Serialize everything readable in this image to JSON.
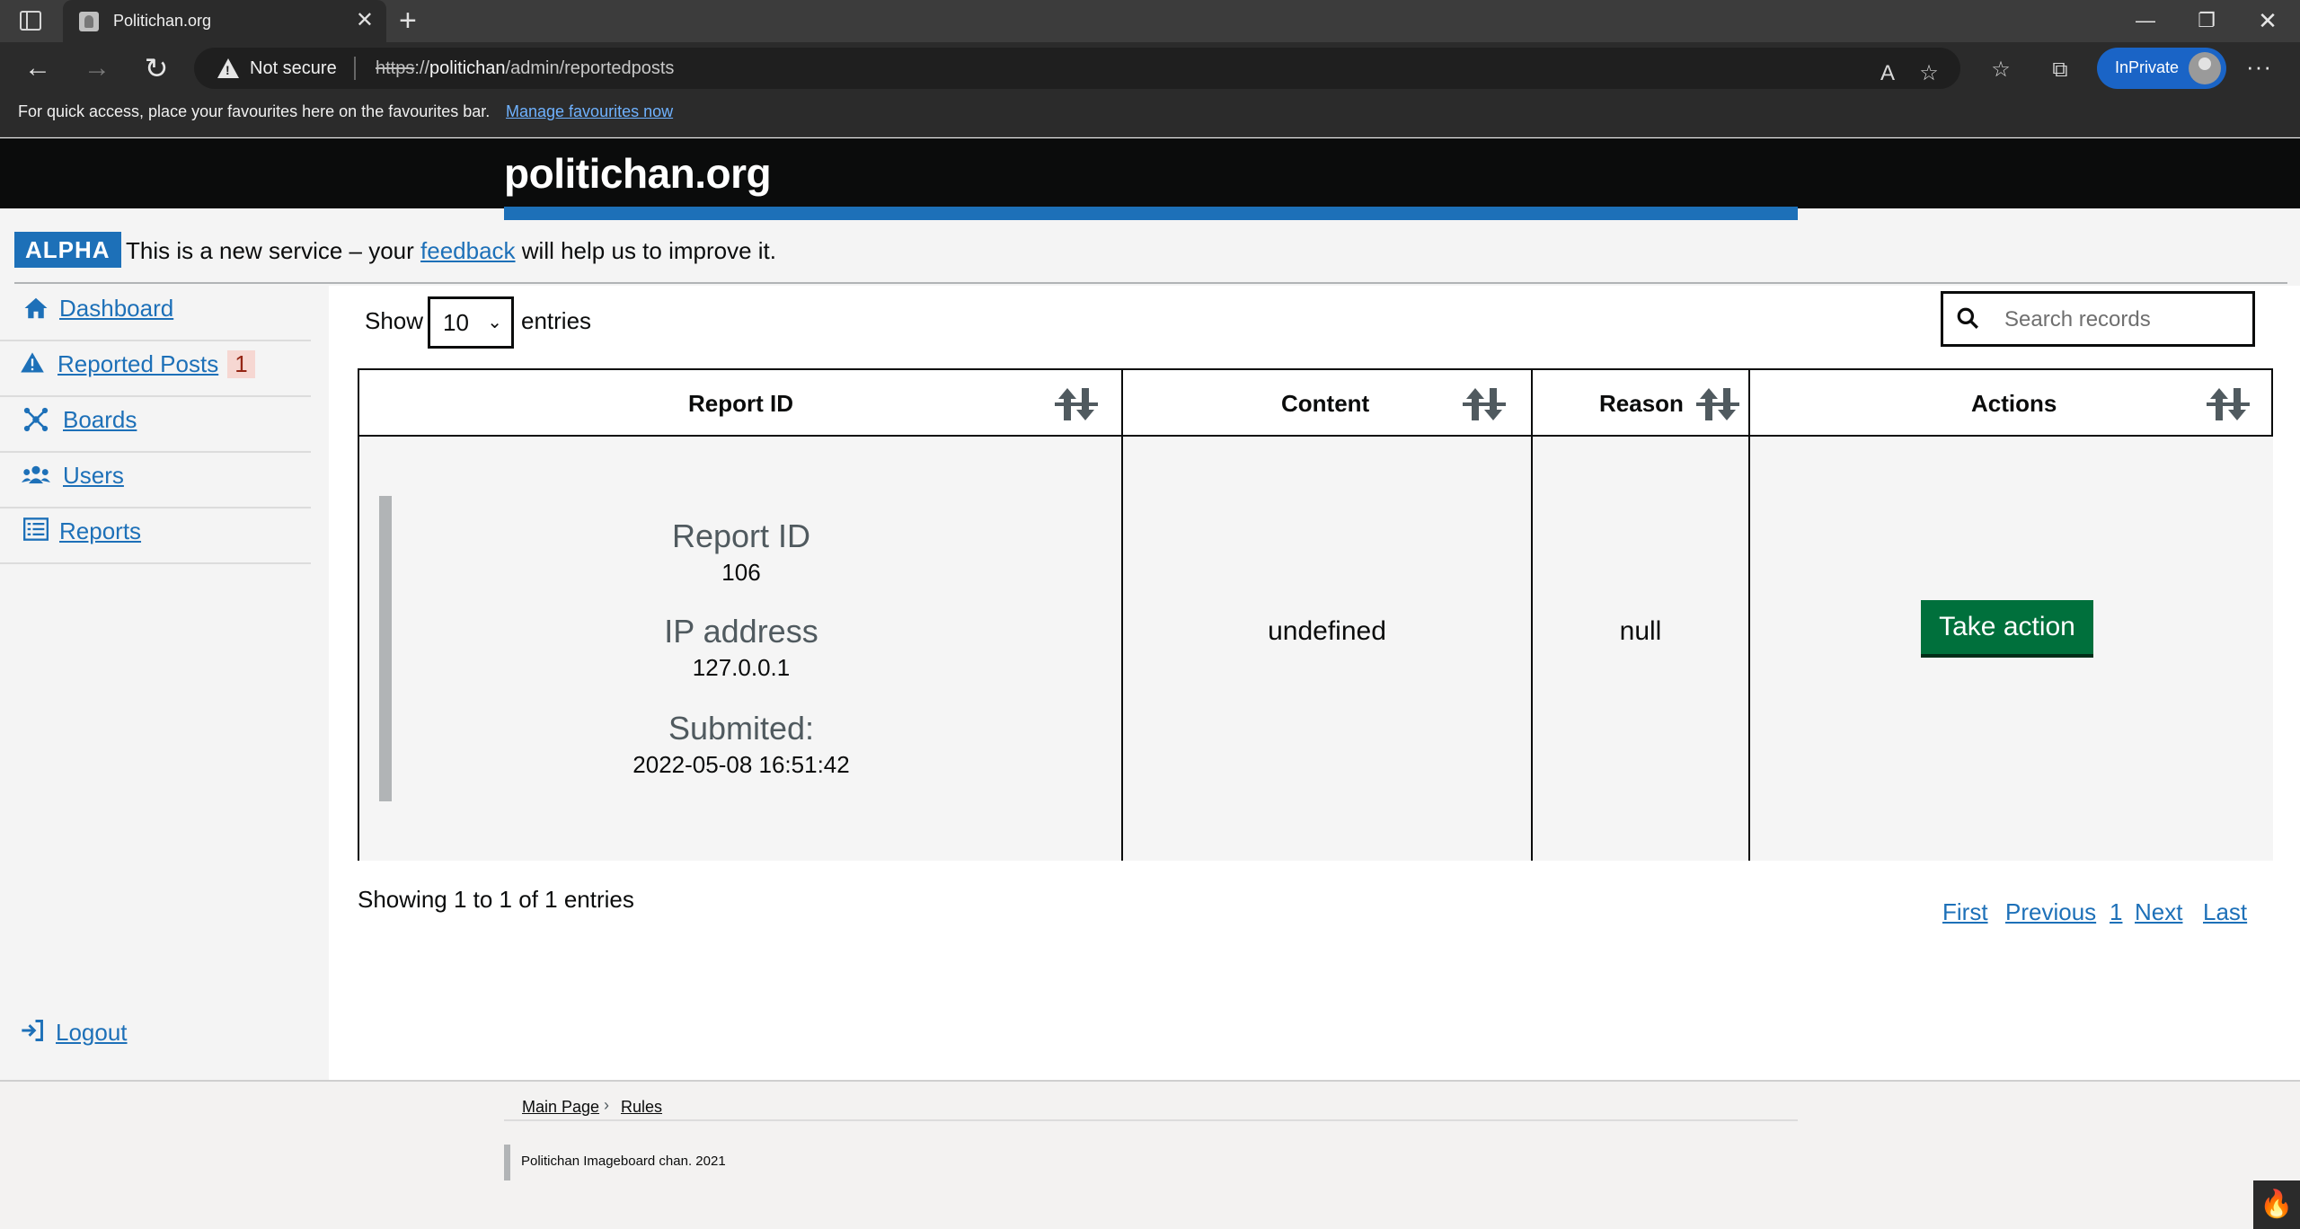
{
  "browser": {
    "tab_title": "Politichan.org",
    "tab_close": "✕",
    "new_tab": "+",
    "not_secure": "Not secure",
    "url_scheme": "https",
    "url_sep": "://",
    "url_host": "politichan",
    "url_path": "/admin/reportedposts",
    "inprivate": "InPrivate",
    "fav_message": "For quick access, place your favourites here on the favourites bar.",
    "fav_link": "Manage favourites now"
  },
  "site": {
    "logo": "politichan.org",
    "alpha_tag": "ALPHA",
    "phase_before": "This is a new service – your ",
    "phase_link": "feedback",
    "phase_after": " will help us to improve it."
  },
  "sidebar": {
    "items": [
      {
        "label": "Dashboard",
        "icon": "home-icon"
      },
      {
        "label": "Reported Posts",
        "icon": "warning-icon",
        "badge": "1"
      },
      {
        "label": "Boards",
        "icon": "boards-icon"
      },
      {
        "label": "Users",
        "icon": "users-icon"
      },
      {
        "label": "Reports",
        "icon": "list-icon"
      }
    ],
    "logout": "Logout"
  },
  "table_controls": {
    "show_label": "Show",
    "page_size": "10",
    "entries_label": "entries",
    "search_placeholder": "Search records"
  },
  "table": {
    "headers": [
      "Report ID",
      "Content",
      "Reason",
      "Actions"
    ],
    "rows": [
      {
        "report_id_label": "Report ID",
        "report_id": "106",
        "ip_label": "IP address",
        "ip": "127.0.0.1",
        "submitted_label": "Submited:",
        "submitted": "2022-05-08 16:51:42",
        "content": "undefined",
        "reason": "null",
        "action": "Take action"
      }
    ]
  },
  "pagination": {
    "summary": "Showing 1 to 1 of 1 entries",
    "first": "First",
    "previous": "Previous",
    "page": "1",
    "next": "Next",
    "last": "Last"
  },
  "footer": {
    "breadcrumb": [
      "Main Page",
      "Rules"
    ],
    "copyright": "Politichan Imageboard chan. 2021"
  },
  "colors": {
    "header_bg": "#0b0c0c",
    "link": "#1d70b8",
    "action_green": "#00703c",
    "alpha_blue": "#1d70b8",
    "badge_bg": "#f6d7d2"
  }
}
